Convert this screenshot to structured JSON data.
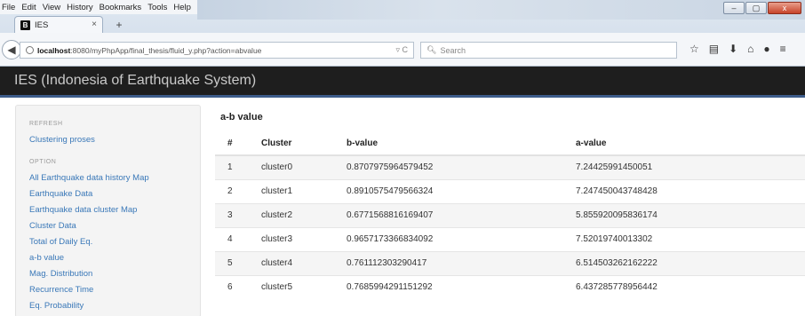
{
  "browser": {
    "menu": [
      "File",
      "Edit",
      "View",
      "History",
      "Bookmarks",
      "Tools",
      "Help"
    ],
    "window_controls": [
      "–",
      "▢",
      "x"
    ],
    "tab": {
      "favicon": "B",
      "title": "IES",
      "close": "×"
    },
    "new_tab": "+",
    "url_host": "localhost",
    "url_rest": ":8080/myPhpApp/final_thesis/fluid_y.php?action=abvalue",
    "search_placeholder": "Search",
    "icons": [
      "star-icon",
      "reading-list-icon",
      "download-icon",
      "home-icon",
      "chat-icon",
      "menu-icon"
    ]
  },
  "site": {
    "brand": "IES (Indonesia of Earthquake System)"
  },
  "sidebar": {
    "refresh_header": "REFRESH",
    "refresh_link": "Clustering proses",
    "option_header": "OPTION",
    "links": [
      "All Earthquake data history Map",
      "Earthquake Data",
      "Earthquake data cluster Map",
      "Cluster Data",
      "Total of Daily Eq.",
      "a-b value",
      "Mag. Distribution",
      "Recurrence Time",
      "Eq. Probability"
    ]
  },
  "main": {
    "title": "a-b value",
    "columns": [
      "#",
      "Cluster",
      "b-value",
      "a-value"
    ],
    "rows": [
      [
        "1",
        "cluster0",
        "0.8707975964579452",
        "7.24425991450051"
      ],
      [
        "2",
        "cluster1",
        "0.8910575479566324",
        "7.247450043748428"
      ],
      [
        "3",
        "cluster2",
        "0.6771568816169407",
        "5.855920095836174"
      ],
      [
        "4",
        "cluster3",
        "0.9657173366834092",
        "7.52019740013302"
      ],
      [
        "5",
        "cluster4",
        "0.761112303290417",
        "6.514503262162222"
      ],
      [
        "6",
        "cluster5",
        "0.7685994291151292",
        "6.437285778956442"
      ]
    ]
  }
}
